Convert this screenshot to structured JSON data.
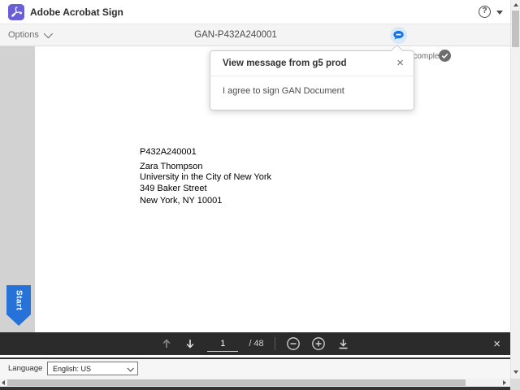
{
  "app": {
    "title": "Adobe Acrobat Sign"
  },
  "topbar": {
    "help_glyph": "?"
  },
  "navbar": {
    "options_label": "Options",
    "document_title": "GAN-P432A240001"
  },
  "status": {
    "fields_completed_text": "red fields completed"
  },
  "message_popup": {
    "title": "View message from g5 prod",
    "body": "I agree to sign GAN Document",
    "close_glyph": "×"
  },
  "document": {
    "lines": [
      "P432A240001",
      "Zara Thompson",
      "University in the City of New York",
      "349 Baker Street",
      "New York, NY 10001"
    ]
  },
  "start_tab": {
    "label": "Start"
  },
  "pager": {
    "current_page": "1",
    "total_pages": "/ 48"
  },
  "toolbar": {
    "close_glyph": "×"
  },
  "language_bar": {
    "label": "Language",
    "selected_option": "English: US"
  },
  "icons": {
    "logo": "adobe-acrobat-sign-logo",
    "message_bubble": "speech-bubble",
    "completed_check": "check-circle"
  },
  "colors": {
    "accent_blue": "#1473e6",
    "start_tab_blue": "#2672d9",
    "logo_purple": "#6a5fd6",
    "toolbar_dark": "#2b2b2b"
  }
}
